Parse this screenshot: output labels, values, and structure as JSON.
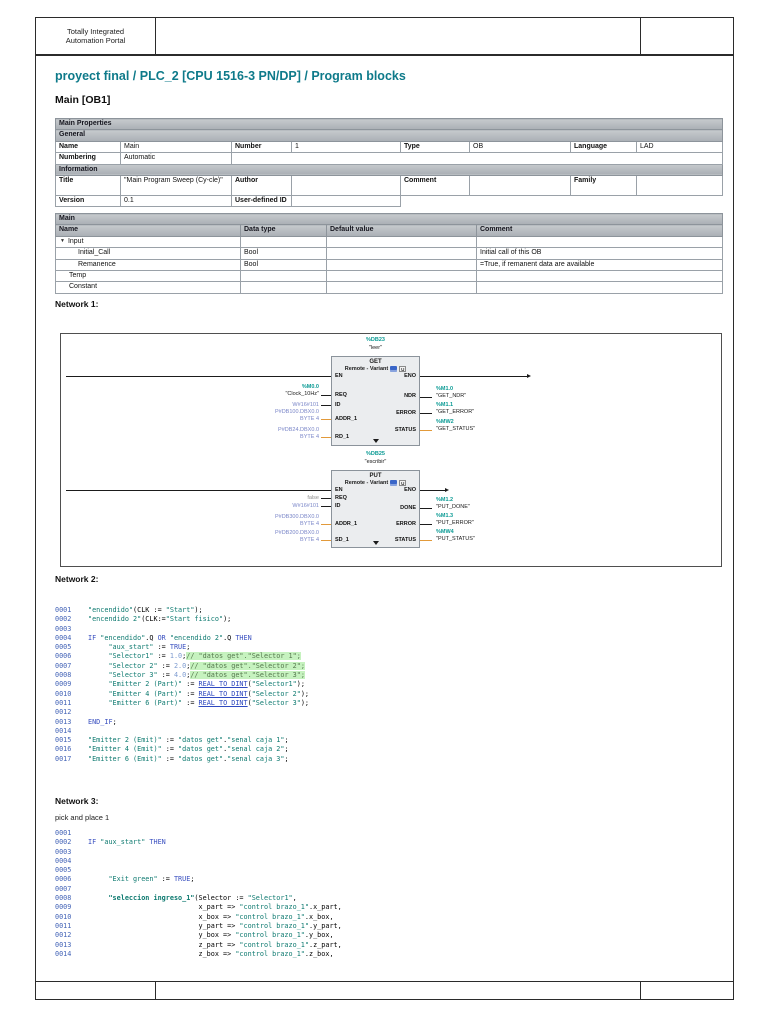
{
  "header": {
    "logo_line1": "Totally Integrated",
    "logo_line2": "Automation Portal"
  },
  "breadcrumb": "proyect final / PLC_2 [CPU 1516-3 PN/DP] / Program blocks",
  "page_title": "Main [OB1]",
  "colors": {
    "accent_teal": "#0e7a8a",
    "operand_teal": "#0a9a94",
    "pointer_blue": "#7a86c8",
    "wire_orange": "#e29a3a",
    "comment_highlight": "#c6f2bf"
  },
  "properties": {
    "section": "Main Properties",
    "general": "General",
    "information": "Information",
    "name_label": "Name",
    "name": "Main",
    "number_label": "Number",
    "number": "1",
    "type_label": "Type",
    "type": "OB",
    "language_label": "Language",
    "language": "LAD",
    "numbering_label": "Numbering",
    "numbering": "Automatic",
    "title_label": "Title",
    "title": "\"Main Program Sweep (Cy-cle)\"",
    "author_label": "Author",
    "author": "",
    "comment_label": "Comment",
    "comment": "",
    "family_label": "Family",
    "family": "",
    "version_label": "Version",
    "version": "0.1",
    "udid_label": "User-defined ID",
    "udid": ""
  },
  "main_table": {
    "title": "Main",
    "headers": [
      "Name",
      "Data type",
      "Default value",
      "Comment"
    ],
    "rows": [
      {
        "name": "Input",
        "lvl": 0,
        "arrow": "▼",
        "dt": "",
        "dv": "",
        "cm": ""
      },
      {
        "name": "Initial_Call",
        "lvl": 2,
        "arrow": "",
        "dt": "Bool",
        "dv": "",
        "cm": "Initial call of this OB"
      },
      {
        "name": "Remanence",
        "lvl": 2,
        "arrow": "",
        "dt": "Bool",
        "dv": "",
        "cm": "=True, if remanent data are available"
      },
      {
        "name": "Temp",
        "lvl": 1,
        "arrow": "",
        "dt": "",
        "dv": "",
        "cm": ""
      },
      {
        "name": "Constant",
        "lvl": 1,
        "arrow": "",
        "dt": "",
        "dv": "",
        "cm": ""
      }
    ]
  },
  "network1": {
    "label": "Network 1:",
    "get": {
      "db": "%DB23",
      "instance": "\"leer\"",
      "title": "GET",
      "subtitle": "Remote  -  Variant",
      "left_pins": [
        "EN",
        "REQ",
        "ID",
        "ADDR_1",
        "RD_1"
      ],
      "right_pins": [
        "ENO",
        "NDR",
        "ERROR",
        "STATUS"
      ],
      "left_operands": [
        {
          "addr": "%M0.0",
          "sym": "\"Clock_10Hz\""
        },
        {
          "addr": "W#16#101",
          "sym": ""
        },
        {
          "addr": "P#DB100.DBX0.0",
          "addr2": "BYTE 4"
        },
        {
          "addr": "P#DB24.DBX0.0",
          "addr2": "BYTE 4"
        }
      ],
      "right_operands": [
        {
          "addr": "%M1.0",
          "sym": "\"GET_NDR\""
        },
        {
          "addr": "%M1.1",
          "sym": "\"GET_ERROR\""
        },
        {
          "addr": "%MW2",
          "sym": "\"GET_STATUS\""
        }
      ]
    },
    "put": {
      "db": "%DB25",
      "instance": "\"escribir\"",
      "title": "PUT",
      "subtitle": "Remote  -  Variant",
      "left_pins": [
        "EN",
        "REQ",
        "ID",
        "ADDR_1",
        "SD_1"
      ],
      "right_pins": [
        "ENO",
        "DONE",
        "ERROR",
        "STATUS"
      ],
      "left_operands": [
        {
          "addr": "false",
          "sym": ""
        },
        {
          "addr": "W#16#101",
          "sym": ""
        },
        {
          "addr": "P#DB300.DBX0.0",
          "addr2": "BYTE 4"
        },
        {
          "addr": "P#DB200.DBX0.0",
          "addr2": "BYTE 4"
        }
      ],
      "right_operands": [
        {
          "addr": "%M1.2",
          "sym": "\"PUT_DONE\""
        },
        {
          "addr": "%M1.3",
          "sym": "\"PUT_ERROR\""
        },
        {
          "addr": "%MW4",
          "sym": "\"PUT_STATUS\""
        }
      ]
    }
  },
  "network2": {
    "label": "Network 2:",
    "lines": [
      {
        "n": "0001",
        "s": [
          [
            "g",
            "\"encendido\""
          ],
          [
            "p",
            "(CLK := "
          ],
          [
            "g",
            "\"Start\""
          ],
          [
            "p",
            ");"
          ]
        ]
      },
      {
        "n": "0002",
        "s": [
          [
            "g",
            "\"encendido 2\""
          ],
          [
            "p",
            "(CLK:="
          ],
          [
            "g",
            "\"Start fisico\""
          ],
          [
            "p",
            ");"
          ]
        ]
      },
      {
        "n": "0003",
        "s": []
      },
      {
        "n": "0004",
        "s": [
          [
            "k",
            "IF "
          ],
          [
            "g",
            "\"encendido\""
          ],
          [
            "p",
            ".Q "
          ],
          [
            "k",
            "OR "
          ],
          [
            "g",
            "\"encendido 2\""
          ],
          [
            "p",
            ".Q "
          ],
          [
            "k",
            "THEN"
          ]
        ]
      },
      {
        "n": "0005",
        "s": [
          [
            "p",
            "     "
          ],
          [
            "g",
            "\"aux_start\""
          ],
          [
            "p",
            " := "
          ],
          [
            "k",
            "TRUE"
          ],
          [
            "p",
            ";"
          ]
        ]
      },
      {
        "n": "0006",
        "s": [
          [
            "p",
            "     "
          ],
          [
            "g",
            "\"Selector1\""
          ],
          [
            "p",
            " := "
          ],
          [
            "n",
            "1.0"
          ],
          [
            "p",
            ";"
          ],
          [
            "c",
            "// \"datos get\".\"Selector 1\";"
          ]
        ]
      },
      {
        "n": "0007",
        "s": [
          [
            "p",
            "     "
          ],
          [
            "g",
            "\"Selector 2\""
          ],
          [
            "p",
            " := "
          ],
          [
            "n",
            "2.0"
          ],
          [
            "p",
            ";"
          ],
          [
            "c",
            "// \"datos get\".\"Selector 2\";"
          ]
        ]
      },
      {
        "n": "0008",
        "s": [
          [
            "p",
            "     "
          ],
          [
            "g",
            "\"Selector 3\""
          ],
          [
            "p",
            " := "
          ],
          [
            "n",
            "4.0"
          ],
          [
            "p",
            ";"
          ],
          [
            "c",
            "// \"datos get\".\"Selector 3\";"
          ]
        ]
      },
      {
        "n": "0009",
        "s": [
          [
            "p",
            "     "
          ],
          [
            "g",
            "\"Emitter 2 (Part)\""
          ],
          [
            "p",
            " := "
          ],
          [
            "f",
            "REAL_TO_DINT"
          ],
          [
            "p",
            "("
          ],
          [
            "g",
            "\"Selector1\""
          ],
          [
            "p",
            ");"
          ]
        ]
      },
      {
        "n": "0010",
        "s": [
          [
            "p",
            "     "
          ],
          [
            "g",
            "\"Emitter 4 (Part)\""
          ],
          [
            "p",
            " := "
          ],
          [
            "f",
            "REAL_TO_DINT"
          ],
          [
            "p",
            "("
          ],
          [
            "g",
            "\"Selector 2\""
          ],
          [
            "p",
            ");"
          ]
        ]
      },
      {
        "n": "0011",
        "s": [
          [
            "p",
            "     "
          ],
          [
            "g",
            "\"Emitter 6 (Part)\""
          ],
          [
            "p",
            " := "
          ],
          [
            "f",
            "REAL_TO_DINT"
          ],
          [
            "p",
            "("
          ],
          [
            "g",
            "\"Selector 3\""
          ],
          [
            "p",
            ");"
          ]
        ]
      },
      {
        "n": "0012",
        "s": []
      },
      {
        "n": "0013",
        "s": [
          [
            "k",
            "END_IF"
          ],
          [
            "p",
            ";"
          ]
        ]
      },
      {
        "n": "0014",
        "s": []
      },
      {
        "n": "0015",
        "s": [
          [
            "g",
            "\"Emitter 2 (Emit)\""
          ],
          [
            "p",
            " := "
          ],
          [
            "g",
            "\"datos get\""
          ],
          [
            "p",
            "."
          ],
          [
            "g",
            "\"senal caja 1\""
          ],
          [
            "p",
            ";"
          ]
        ]
      },
      {
        "n": "0016",
        "s": [
          [
            "g",
            "\"Emitter 4 (Emit)\""
          ],
          [
            "p",
            " := "
          ],
          [
            "g",
            "\"datos get\""
          ],
          [
            "p",
            "."
          ],
          [
            "g",
            "\"senal caja 2\""
          ],
          [
            "p",
            ";"
          ]
        ]
      },
      {
        "n": "0017",
        "s": [
          [
            "g",
            "\"Emitter 6 (Emit)\""
          ],
          [
            "p",
            " := "
          ],
          [
            "g",
            "\"datos get\""
          ],
          [
            "p",
            "."
          ],
          [
            "g",
            "\"senal caja 3\""
          ],
          [
            "p",
            ";"
          ]
        ]
      }
    ]
  },
  "network3": {
    "label": "Network 3:",
    "subtitle": "pick and place 1",
    "lines": [
      {
        "n": "0001",
        "s": []
      },
      {
        "n": "0002",
        "s": [
          [
            "k",
            "IF "
          ],
          [
            "g",
            "\"aux_start\""
          ],
          [
            "p",
            " "
          ],
          [
            "k",
            "THEN"
          ]
        ]
      },
      {
        "n": "0003",
        "s": []
      },
      {
        "n": "0004",
        "s": []
      },
      {
        "n": "0005",
        "s": []
      },
      {
        "n": "0006",
        "s": [
          [
            "p",
            "     "
          ],
          [
            "g",
            "\"Exit green\""
          ],
          [
            "p",
            " := "
          ],
          [
            "k",
            "TRUE"
          ],
          [
            "p",
            ";"
          ]
        ]
      },
      {
        "n": "0007",
        "s": []
      },
      {
        "n": "0008",
        "s": [
          [
            "p",
            "     "
          ],
          [
            "b",
            "\"seleccion ingreso_1\""
          ],
          [
            "p",
            "(Selector := "
          ],
          [
            "g",
            "\"Selector1\""
          ],
          [
            "p",
            ","
          ]
        ]
      },
      {
        "n": "0009",
        "s": [
          [
            "p",
            "                           x_part => "
          ],
          [
            "g",
            "\"control brazo_1\""
          ],
          [
            "p",
            ".x_part,"
          ]
        ]
      },
      {
        "n": "0010",
        "s": [
          [
            "p",
            "                           x_box => "
          ],
          [
            "g",
            "\"control brazo_1\""
          ],
          [
            "p",
            ".x_box,"
          ]
        ]
      },
      {
        "n": "0011",
        "s": [
          [
            "p",
            "                           y_part => "
          ],
          [
            "g",
            "\"control brazo_1\""
          ],
          [
            "p",
            ".y_part,"
          ]
        ]
      },
      {
        "n": "0012",
        "s": [
          [
            "p",
            "                           y_box => "
          ],
          [
            "g",
            "\"control brazo_1\""
          ],
          [
            "p",
            ".y_box,"
          ]
        ]
      },
      {
        "n": "0013",
        "s": [
          [
            "p",
            "                           z_part => "
          ],
          [
            "g",
            "\"control brazo_1\""
          ],
          [
            "p",
            ".z_part,"
          ]
        ]
      },
      {
        "n": "0014",
        "s": [
          [
            "p",
            "                           z_box => "
          ],
          [
            "g",
            "\"control brazo_1\""
          ],
          [
            "p",
            ".z_box,"
          ]
        ]
      }
    ]
  }
}
